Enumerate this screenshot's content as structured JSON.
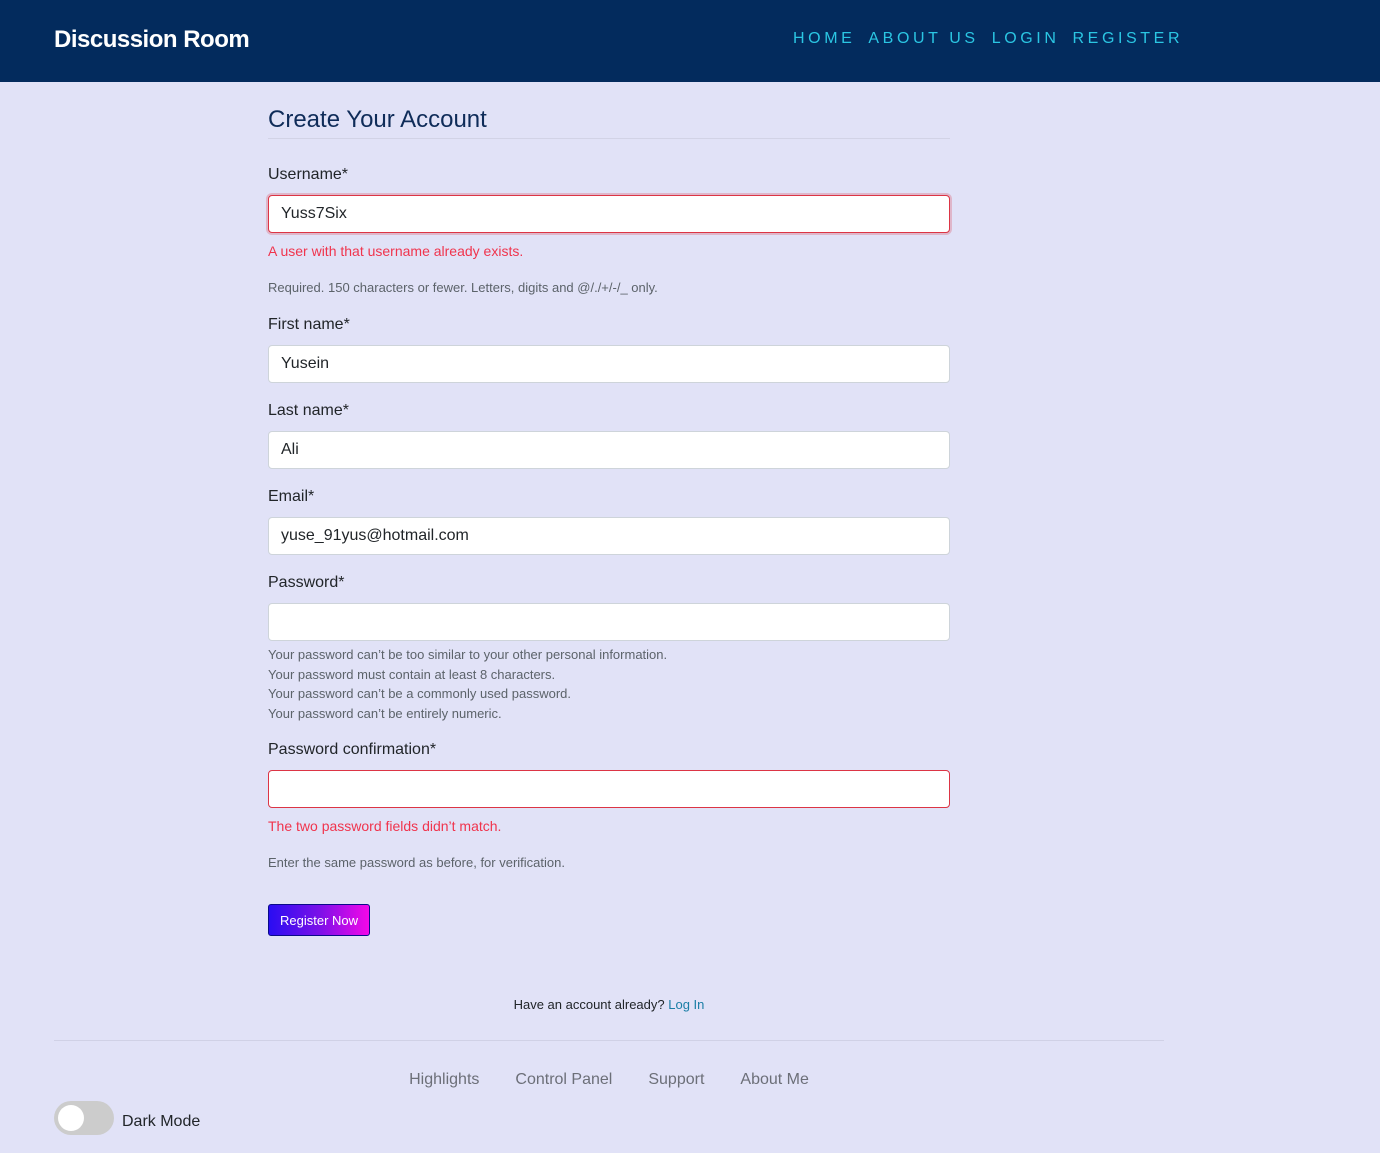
{
  "navbar": {
    "brand": "Discussion Room",
    "links": [
      "HOME",
      "ABOUT US",
      "LOGIN",
      "REGISTER"
    ]
  },
  "form": {
    "title": "Create Your Account",
    "username": {
      "label": "Username*",
      "value": "Yuss7Six",
      "error": "A user with that username already exists.",
      "help": "Required. 150 characters or fewer. Letters, digits and @/./+/-/_ only."
    },
    "first_name": {
      "label": "First name*",
      "value": "Yusein"
    },
    "last_name": {
      "label": "Last name*",
      "value": "Ali"
    },
    "email": {
      "label": "Email*",
      "value": "yuse_91yus@hotmail.com"
    },
    "password": {
      "label": "Password*",
      "value": "",
      "help": [
        "Your password can’t be too similar to your other personal information.",
        "Your password must contain at least 8 characters.",
        "Your password can’t be a commonly used password.",
        "Your password can’t be entirely numeric."
      ]
    },
    "password_confirmation": {
      "label": "Password confirmation*",
      "value": "",
      "error": "The two password fields didn’t match.",
      "help": "Enter the same password as before, for verification."
    },
    "submit_label": "Register Now"
  },
  "login_prompt": {
    "text": "Have an account already?",
    "link": "Log In"
  },
  "footer": {
    "links": [
      "Highlights",
      "Control Panel",
      "Support",
      "About Me"
    ],
    "dark_mode_label": "Dark Mode",
    "dark_mode_on": false
  },
  "colors": {
    "navbar_bg": "#032b5d",
    "page_bg": "#e1e2f7",
    "nav_link": "#2bc6e3",
    "error": "#f0344d",
    "button_gradient_start": "#2a0df2",
    "button_gradient_end": "#f308e8"
  }
}
